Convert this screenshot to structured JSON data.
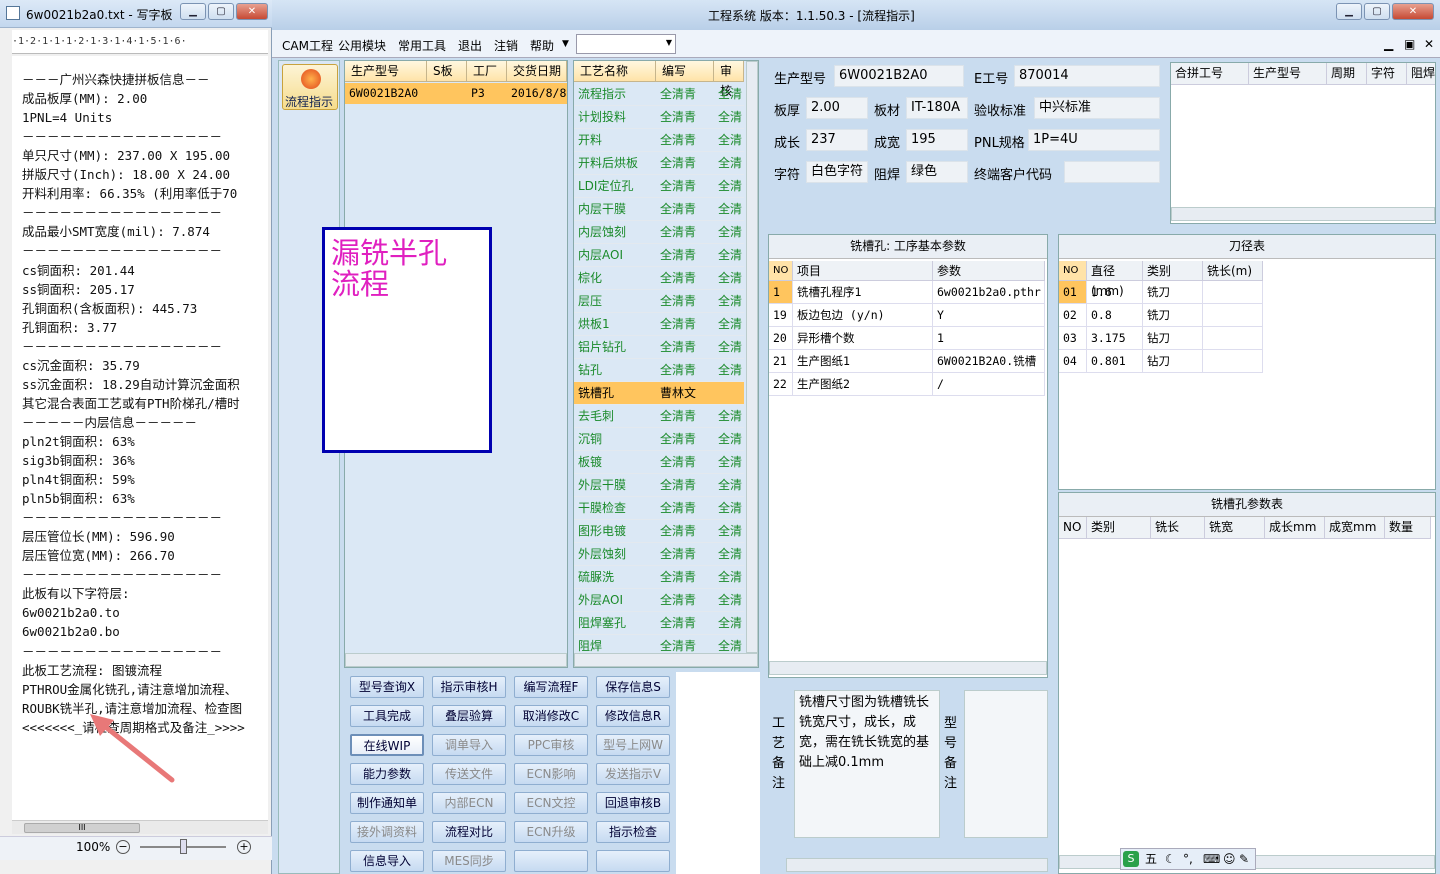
{
  "wordpad": {
    "title": "6w0021b2a0.txt - 写字板",
    "ruler": "·1·2·1·1·1·2·1·3·1·4·1·5·1·6·",
    "lines": [
      "－－－广州兴森快捷拼板信息－－",
      "成品板厚(MM): 2.00",
      "1PNL=4 Units",
      "－－－－－－－－－－－－－－－－",
      "单只尺寸(MM): 237.00 X 195.00",
      "拼版尺寸(Inch): 18.00 X 24.00",
      "开料利用率: 66.35% (利用率低于70",
      "－－－－－－－－－－－－－－－－",
      "成品最小SMT宽度(mil): 7.874",
      "－－－－－－－－－－－－－－－－",
      "cs铜面积: 201.44",
      "ss铜面积: 205.17",
      "孔铜面积(含板面积): 445.73",
      "孔铜面积: 3.77",
      "－－－－－－－－－－－－－－－－",
      "cs沉金面积: 35.79",
      "ss沉金面积: 18.29自动计算沉金面积",
      "其它混合表面工艺或有PTH阶梯孔/槽时",
      "－－－－－内层信息－－－－－",
      "pln2t铜面积: 63%",
      "sig3b铜面积: 36%",
      "pln4t铜面积: 59%",
      "pln5b铜面积: 63%",
      "－－－－－－－－－－－－－－－－",
      "层压管位长(MM): 596.90",
      "层压管位宽(MM): 266.70",
      "－－－－－－－－－－－－－－－－",
      "此板有以下字符层:",
      "6w0021b2a0.to",
      "6w0021b2a0.bo",
      "－－－－－－－－－－－－－－－－",
      "此板工艺流程: 图镀流程",
      "PTHROU金属化铣孔,请注意增加流程、",
      "ROUBK铣半孔,请注意增加流程、检查图",
      "<<<<<<<_请检查周期格式及备注_>>>>"
    ],
    "zoom": "100%",
    "hscroll": "III"
  },
  "main": {
    "title": "工程系统  版本：1.1.50.3 - [流程指示]",
    "menu": [
      "CAM工程",
      "公用模块",
      "常用工具",
      "退出",
      "注销",
      "帮助"
    ],
    "nav_button": "流程指示",
    "orders": {
      "headers": [
        "生产型号",
        "S板",
        "工厂",
        "交货日期"
      ],
      "rows": [
        [
          "6W0021B2A0",
          "",
          "P3",
          "2016/8/8"
        ]
      ]
    },
    "process": {
      "headers": [
        "工艺名称",
        "编写",
        "审核"
      ],
      "rows": [
        [
          "流程指示",
          "全清青",
          "全清"
        ],
        [
          "计划投料",
          "全清青",
          "全清"
        ],
        [
          "开料",
          "全清青",
          "全清"
        ],
        [
          "开料后烘板",
          "全清青",
          "全清"
        ],
        [
          "LDI定位孔",
          "全清青",
          "全清"
        ],
        [
          "内层干膜",
          "全清青",
          "全清"
        ],
        [
          "内层蚀刻",
          "全清青",
          "全清"
        ],
        [
          "内层AOI",
          "全清青",
          "全清"
        ],
        [
          "棕化",
          "全清青",
          "全清"
        ],
        [
          "层压",
          "全清青",
          "全清"
        ],
        [
          "烘板1",
          "全清青",
          "全清"
        ],
        [
          "铝片钻孔",
          "全清青",
          "全清"
        ],
        [
          "钻孔",
          "全清青",
          "全清"
        ],
        [
          "铣槽孔",
          "曹林文",
          ""
        ],
        [
          "去毛刺",
          "全清青",
          "全清"
        ],
        [
          "沉铜",
          "全清青",
          "全清"
        ],
        [
          "板镀",
          "全清青",
          "全清"
        ],
        [
          "外层干膜",
          "全清青",
          "全清"
        ],
        [
          "干膜检查",
          "全清青",
          "全清"
        ],
        [
          "图形电镀",
          "全清青",
          "全清"
        ],
        [
          "外层蚀刻",
          "全清青",
          "全清"
        ],
        [
          "硫脲洗",
          "全清青",
          "全清"
        ],
        [
          "外层AOI",
          "全清青",
          "全清"
        ],
        [
          "阻焊塞孔",
          "全清青",
          "全清"
        ],
        [
          "阻焊",
          "全清青",
          "全清"
        ]
      ],
      "selected_index": 13
    },
    "note_box": [
      "漏铣半孔",
      "流程"
    ],
    "buttons": [
      [
        "型号查询X",
        "指示审核H",
        "编写流程F",
        "保存信息S"
      ],
      [
        "工具完成",
        "叠层验算",
        "取消修改C",
        "修改信息R"
      ],
      [
        "在线WIP",
        "调单导入",
        "PPC审核",
        "型号上网W"
      ],
      [
        "能力参数",
        "传送文件",
        "ECN影响",
        "发送指示V"
      ],
      [
        "制作通知单",
        "内部ECN",
        "ECN文控",
        "回退审核B"
      ],
      [
        "接外调资料",
        "流程对比",
        "ECN升级",
        "指示检查"
      ],
      [
        "信息导入",
        "MES同步",
        "",
        ""
      ]
    ],
    "buttons_disabled": [
      [
        false,
        false,
        false,
        false
      ],
      [
        false,
        false,
        false,
        false
      ],
      [
        false,
        true,
        true,
        true
      ],
      [
        false,
        true,
        true,
        true
      ],
      [
        false,
        true,
        true,
        false
      ],
      [
        true,
        false,
        true,
        false
      ],
      [
        false,
        true,
        false,
        false
      ]
    ],
    "info": {
      "prod_model_label": "生产型号",
      "prod_model": "6W0021B2A0",
      "e_no_label": "E工号",
      "e_no": "870014",
      "thickness_label": "板厚",
      "thickness": "2.00",
      "material_label": "板材",
      "material": "IT-180A",
      "standard_label": "验收标准",
      "standard": "中兴标准",
      "len_label": "成长",
      "len": "237",
      "wid_label": "成宽",
      "wid": "195",
      "pnl_label": "PNL规格",
      "pnl": "1P=4U",
      "char_label": "字符",
      "char": "白色字符",
      "mask_label": "阻焊",
      "mask": "绿色",
      "cust_label": "终端客户代码",
      "cust": ""
    },
    "merge_table": {
      "headers": [
        "合拼工号",
        "生产型号",
        "周期",
        "字符",
        "阻焊"
      ]
    },
    "params": {
      "title": "铣槽孔: 工序基本参数",
      "headers": [
        "NO",
        "项目",
        "参数"
      ],
      "rows": [
        [
          "1",
          "铣槽孔程序1",
          "6w0021b2a0.pthr"
        ],
        [
          "19",
          "板边包边 (y/n)",
          "Y"
        ],
        [
          "20",
          "异形槽个数",
          "1"
        ],
        [
          "21",
          "生产图纸1",
          "6W0021B2A0.铣槽"
        ],
        [
          "22",
          "生产图纸2",
          "/"
        ]
      ]
    },
    "tools": {
      "title": "刀径表",
      "headers": [
        "NO",
        "直径(mm)",
        "类别",
        "铣长(m)"
      ],
      "rows": [
        [
          "01",
          "1.6",
          "铣刀",
          ""
        ],
        [
          "02",
          "0.8",
          "铣刀",
          ""
        ],
        [
          "03",
          "3.175",
          "钻刀",
          ""
        ],
        [
          "04",
          "0.801",
          "钻刀",
          ""
        ]
      ]
    },
    "slot_table": {
      "title": "铣槽孔参数表",
      "headers": [
        "NO",
        "类别",
        "铣长(mm)",
        "铣宽(mm)",
        "成长mm",
        "成宽mm",
        "数量"
      ]
    },
    "remarks": {
      "label": "工艺备注",
      "text": "铣槽尺寸图为铣槽铣长铣宽尺寸，成长，成宽，需在铣长铣宽的基础上减0.1mm",
      "type_label": "型号备注"
    },
    "ime": [
      "五",
      "°,",
      "⌨"
    ]
  },
  "colors": {
    "selected": "#ffc55e",
    "header": "#ffe3a8",
    "green": "#1a8a2a",
    "magenta": "#e020c0",
    "accent": "#0000b0"
  }
}
